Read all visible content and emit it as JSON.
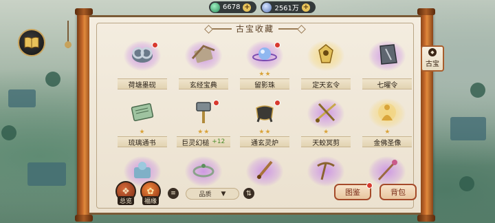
{
  "currency": [
    {
      "id": "jade",
      "icon": "jade-coin-icon",
      "amount": "6678"
    },
    {
      "id": "silver",
      "icon": "silver-coin-icon",
      "amount": "2561万"
    }
  ],
  "panel": {
    "title": "古宝收藏",
    "side_tab_label": "古宝"
  },
  "items": [
    {
      "name": "荷塘墨砚",
      "stars": 0,
      "red_dot": true,
      "glow": "purple",
      "icon": "inkstone-icon"
    },
    {
      "name": "玄经宝典",
      "stars": 0,
      "red_dot": false,
      "glow": "purple",
      "icon": "scroll-book-icon"
    },
    {
      "name": "留影珠",
      "stars": 2,
      "red_dot": true,
      "glow": "purple",
      "icon": "orb-icon"
    },
    {
      "name": "定天玄令",
      "stars": 0,
      "red_dot": false,
      "glow": "gold",
      "icon": "token-icon"
    },
    {
      "name": "七曜令",
      "stars": 0,
      "red_dot": false,
      "glow": "purple",
      "icon": "tablet-icon"
    },
    {
      "name": "琉璃通书",
      "stars": 1,
      "red_dot": false,
      "glow": "none",
      "icon": "jade-book-icon"
    },
    {
      "name": "巨灵幻槌",
      "stars": 2,
      "red_dot": true,
      "glow": "none",
      "icon": "hammer-icon",
      "bonus": "+12"
    },
    {
      "name": "通玄灵炉",
      "stars": 2,
      "red_dot": true,
      "glow": "none",
      "icon": "cauldron-icon"
    },
    {
      "name": "天蛟冥剪",
      "stars": 1,
      "red_dot": false,
      "glow": "purple",
      "icon": "scissors-icon"
    },
    {
      "name": "金佛圣像",
      "stars": 1,
      "red_dot": false,
      "glow": "gold",
      "icon": "buddha-icon"
    },
    {
      "name": "",
      "stars": 0,
      "red_dot": false,
      "glow": "purple",
      "icon": "beast-icon"
    },
    {
      "name": "",
      "stars": 0,
      "red_dot": false,
      "glow": "purple",
      "icon": "ring-icon"
    },
    {
      "name": "",
      "stars": 0,
      "red_dot": false,
      "glow": "purple",
      "icon": "dagger-icon"
    },
    {
      "name": "",
      "stars": 0,
      "red_dot": false,
      "glow": "purple",
      "icon": "pickaxe-icon"
    },
    {
      "name": "",
      "stars": 0,
      "red_dot": false,
      "glow": "purple",
      "icon": "staff-icon"
    }
  ],
  "bottom": {
    "overview_label": "总览",
    "blessing_label": "福缘",
    "sort_value": "品质",
    "atlas_label": "图鉴",
    "bag_label": "背包"
  },
  "colors": {
    "accent": "#a44a2a",
    "star": "#d9a33a",
    "red_dot": "#d83a2e",
    "bonus": "#4a8a2a"
  }
}
